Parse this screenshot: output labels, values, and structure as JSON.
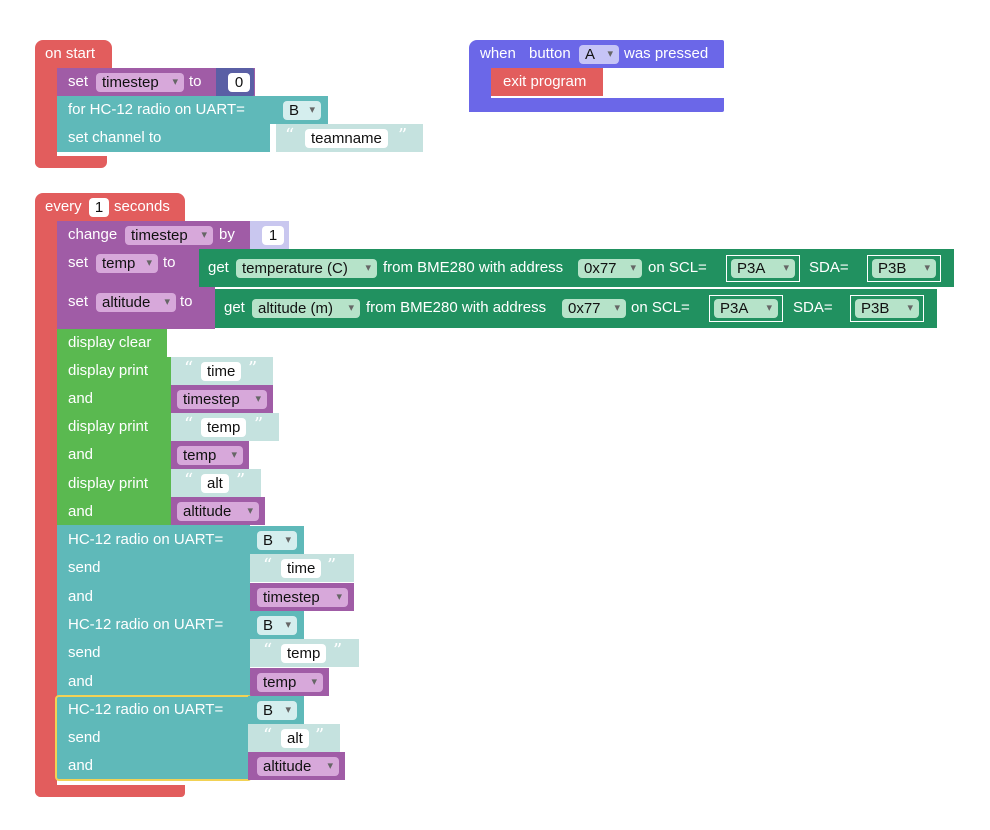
{
  "on_start": {
    "hat_label": "on start",
    "set_label": "set",
    "timestep_var": "timestep",
    "to_label": "to",
    "timestep_value": "0",
    "radio_label": "for HC-12 radio on UART=",
    "uart_value": "B",
    "channel_label": "set channel to",
    "teamname": "teamname"
  },
  "button_event": {
    "when_label": "when",
    "button_label": "button",
    "button_value": "A",
    "pressed_label": "was pressed",
    "exit_label": "exit program"
  },
  "every": {
    "every_label": "every",
    "interval": "1",
    "seconds_label": "seconds",
    "change_label": "change",
    "change_var": "timestep",
    "by_label": "by",
    "change_by": "1",
    "set_label": "set",
    "to_label": "to",
    "temp_var": "temp",
    "altitude_var": "altitude",
    "get_label": "get",
    "temp_reading": "temperature (C)",
    "alt_reading": "altitude (m)",
    "from_label": "from BME280 with address",
    "address": "0x77",
    "scl_label": "on SCL=",
    "scl_value": "P3A",
    "sda_label": "SDA=",
    "sda_value": "P3B",
    "display_clear": "display clear",
    "display_print": "display print",
    "and_label": "and",
    "str_time": "time",
    "str_temp": "temp",
    "str_alt": "alt",
    "radio_label": "HC-12 radio on UART=",
    "uart_value": "B",
    "send_label": "send",
    "var_timestep": "timestep",
    "var_temp": "temp",
    "var_altitude": "altitude"
  },
  "glyphs": {
    "open_quote": "“",
    "close_quote": "”"
  }
}
